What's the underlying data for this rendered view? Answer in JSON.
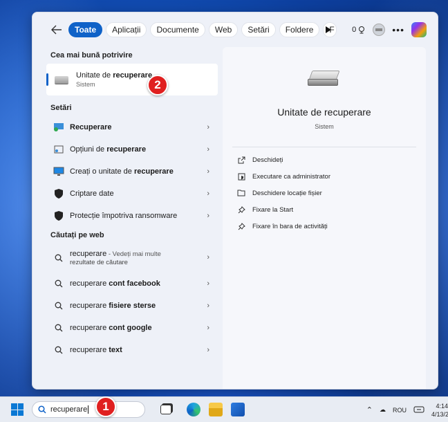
{
  "filters": {
    "back": "←",
    "chips": [
      "Toate",
      "Aplicații",
      "Documente",
      "Web",
      "Setări",
      "Foldere",
      "F"
    ],
    "points": "0"
  },
  "best_match": {
    "section": "Cea mai bună potrivire",
    "title_prefix": "Unitate de ",
    "title_bold": "recuperare",
    "subtitle": "Sistem"
  },
  "settings": {
    "section": "Setări",
    "items": [
      {
        "prefix": "",
        "bold": "Recuperare",
        "suffix": ""
      },
      {
        "prefix": "Opțiuni de ",
        "bold": "recuperare",
        "suffix": ""
      },
      {
        "prefix": "Creați o unitate de ",
        "bold": "recuperare",
        "suffix": ""
      },
      {
        "prefix": "Criptare date",
        "bold": "",
        "suffix": ""
      },
      {
        "prefix": "Protecție împotriva ransomware",
        "bold": "",
        "suffix": ""
      }
    ]
  },
  "web": {
    "section": "Căutați pe web",
    "first": {
      "term": "recuperare",
      "more": " - Vedeți mai multe",
      "more2": "rezultate de căutare"
    },
    "items": [
      {
        "prefix": "recuperare ",
        "bold": "cont facebook"
      },
      {
        "prefix": "recuperare ",
        "bold": "fisiere sterse"
      },
      {
        "prefix": "recuperare ",
        "bold": "cont google"
      },
      {
        "prefix": "recuperare ",
        "bold": "text"
      }
    ]
  },
  "preview": {
    "title": "Unitate de recuperare",
    "subtitle": "Sistem",
    "actions": [
      "Deschideți",
      "Executare ca administrator",
      "Deschidere locație fișier",
      "Fixare la Start",
      "Fixare în bara de activități"
    ]
  },
  "taskbar": {
    "search_value": "recuperare",
    "lang": "ROU",
    "time": "4:14",
    "date": "4/13/2"
  },
  "badges": {
    "one": "1",
    "two": "2"
  }
}
